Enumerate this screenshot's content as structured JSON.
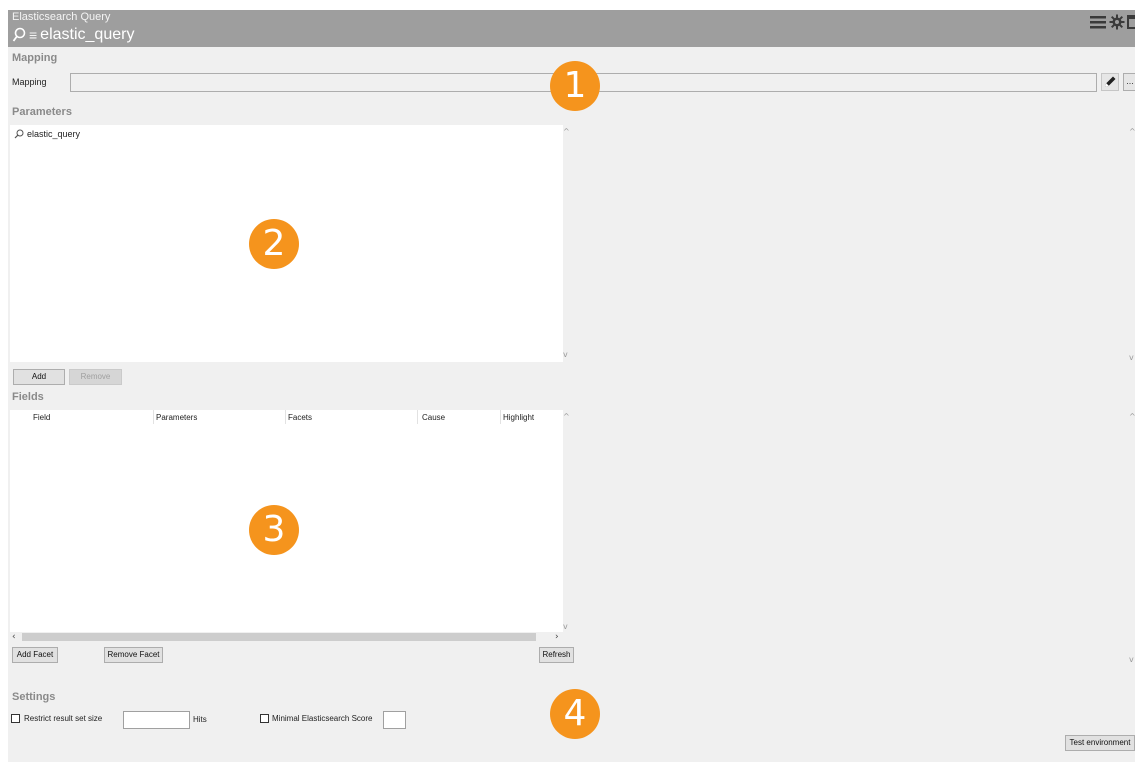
{
  "window": {
    "app_name": "Elasticsearch Query",
    "title": "elastic_query"
  },
  "mapping": {
    "heading": "Mapping",
    "label": "Mapping",
    "value": "",
    "browse_label": "..."
  },
  "parameters": {
    "heading": "Parameters",
    "items": [
      {
        "label": "elastic_query"
      }
    ],
    "add_label": "Add",
    "remove_label": "Remove"
  },
  "fields": {
    "heading": "Fields",
    "columns": [
      "Field",
      "Parameters",
      "Facets",
      "Cause",
      "Highlight"
    ],
    "rows": [],
    "add_facet_label": "Add Facet",
    "remove_facet_label": "Remove Facet",
    "refresh_label": "Refresh"
  },
  "settings": {
    "heading": "Settings",
    "restrict_label": "Restrict result set size",
    "restrict_checked": false,
    "hits_value": "",
    "hits_label": "Hits",
    "min_score_label": "Minimal Elasticsearch Score",
    "min_score_checked": false,
    "min_score_value": "",
    "test_env_label": "Test environment"
  },
  "callouts": [
    "1",
    "2",
    "3",
    "4"
  ],
  "icons": {
    "title_search": "search-icon",
    "title_menu": "menu-icon",
    "hamburger": "hamburger-icon",
    "settings": "gear-icon",
    "window": "window-icon",
    "edit": "pencil-icon",
    "param_item": "search-icon"
  },
  "colors": {
    "titlebar": "#9e9e9e",
    "callout": "#f5941d",
    "background": "#f0f0f0",
    "heading": "#8a8a8a"
  }
}
